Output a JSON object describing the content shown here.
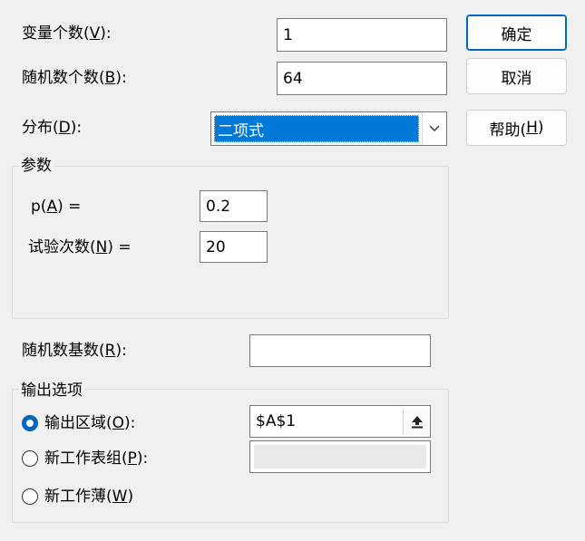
{
  "fields": {
    "variable_count": {
      "label": "变量个数(",
      "mnemonic": "V",
      "label_end": "):",
      "value": "1"
    },
    "random_count": {
      "label": "随机数个数(",
      "mnemonic": "B",
      "label_end": "):",
      "value": "64"
    },
    "distribution": {
      "label": "分布(",
      "mnemonic": "D",
      "label_end": "):",
      "value": "二项式"
    },
    "seed": {
      "label": "随机数基数(",
      "mnemonic": "R",
      "label_end": "):",
      "value": ""
    }
  },
  "buttons": {
    "ok": "确定",
    "cancel": "取消",
    "help_label": "帮助(",
    "help_mnemonic": "H",
    "help_end": ")"
  },
  "parameters": {
    "title": "参数",
    "p": {
      "label": "p(",
      "mnemonic": "A",
      "label_end": ") =",
      "value": "0.2"
    },
    "trials": {
      "label": "试验次数(",
      "mnemonic": "N",
      "label_end": ") =",
      "value": "20"
    }
  },
  "output": {
    "title": "输出选项",
    "range": {
      "label": "输出区域(",
      "mnemonic": "O",
      "label_end": "):",
      "value": "$A$1",
      "checked": true
    },
    "new_sheet": {
      "label": "新工作表组(",
      "mnemonic": "P",
      "label_end": "):",
      "value": "",
      "checked": false
    },
    "new_workbook": {
      "label": "新工作薄(",
      "mnemonic": "W",
      "label_end": ")",
      "checked": false
    }
  },
  "icons": {
    "dropdown": "chevron-down-icon",
    "range_picker": "collapse-dialog-icon"
  },
  "colors": {
    "accent": "#0067c0",
    "selection": "#0078d7",
    "background": "#f0f0f0"
  }
}
